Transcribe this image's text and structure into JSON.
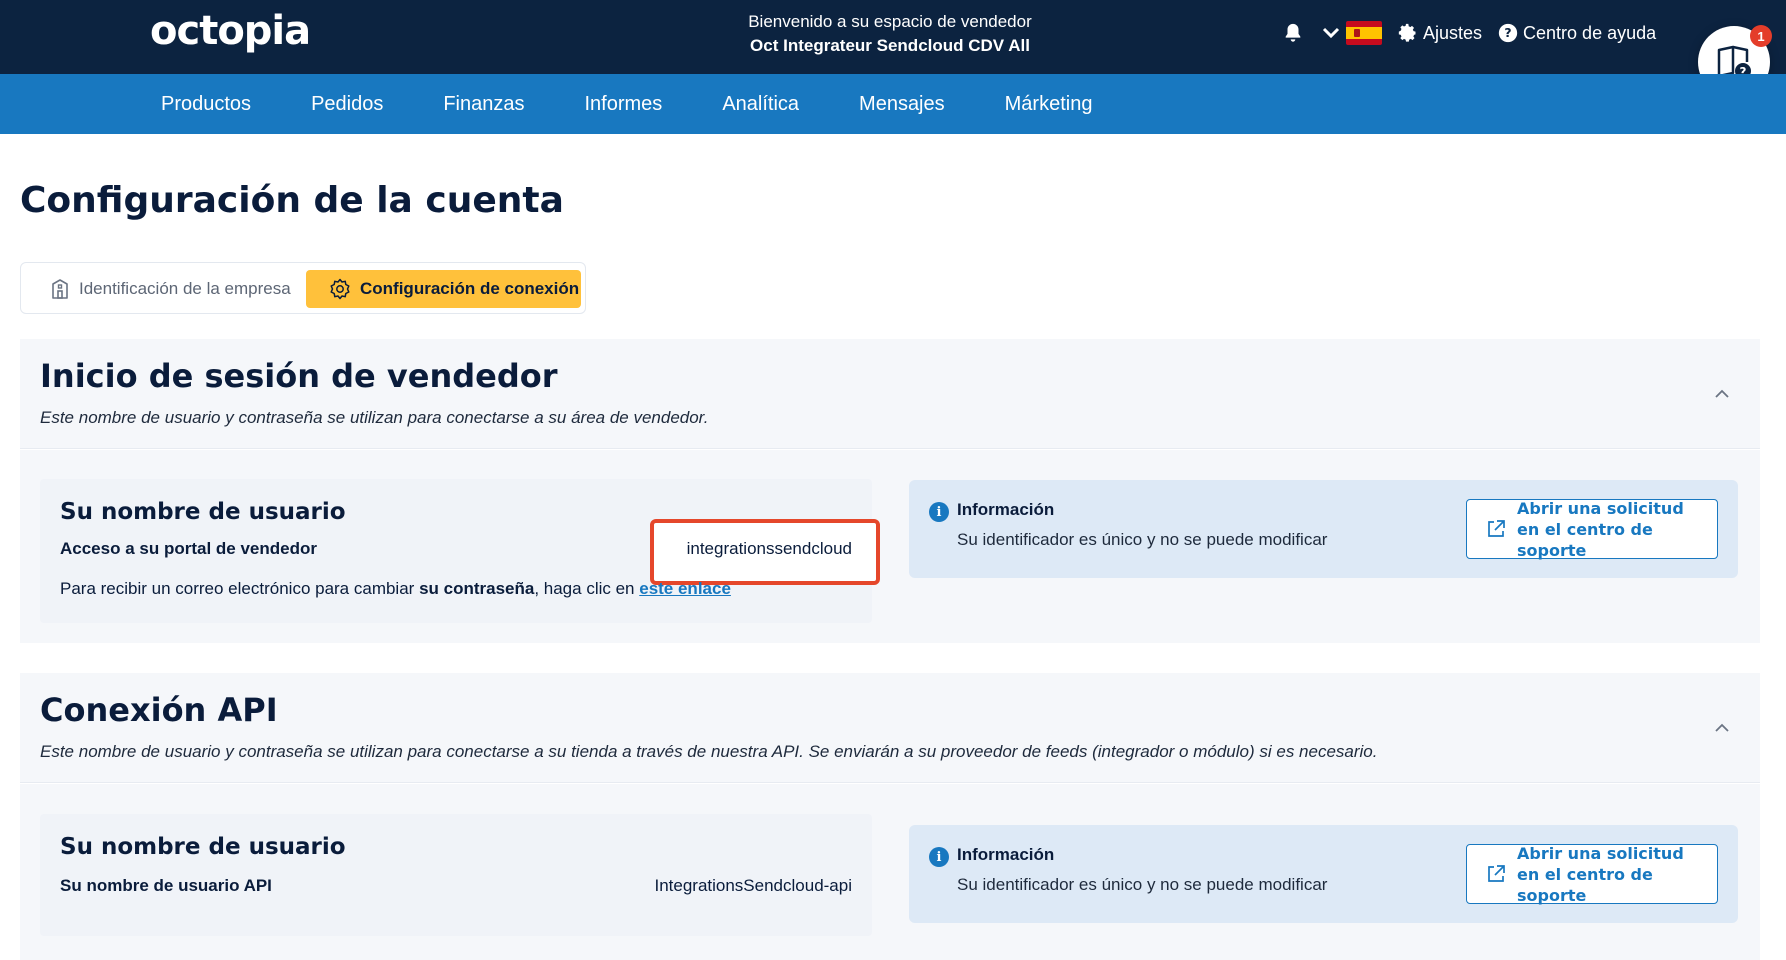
{
  "header": {
    "logo": "octopia",
    "welcome_line": "Bienvenido a su espacio de vendedor",
    "store_name": "Oct Integrateur Sendcloud CDV All",
    "settings_label": "Ajustes",
    "help_center_label": "Centro de ayuda",
    "help_badge_count": "1"
  },
  "nav": {
    "items": [
      "Productos",
      "Pedidos",
      "Finanzas",
      "Informes",
      "Analítica",
      "Mensajes",
      "Márketing"
    ]
  },
  "page": {
    "title": "Configuración de la cuenta"
  },
  "tabs": {
    "company": "Identificación de la empresa",
    "connection": "Configuración de conexión",
    "active": "connection"
  },
  "seller_login": {
    "title": "Inicio de sesión de vendedor",
    "subtitle": "Este nombre de usuario y contraseña se utilizan para conectarse a su área de vendedor.",
    "card_title": "Su nombre de usuario",
    "field_label": "Acceso a su portal de vendedor",
    "field_value": "integrationssendcloud",
    "note_prefix": "Para recibir un correo electrónico para cambiar ",
    "note_bold": "su contraseña",
    "note_mid": ", haga clic en ",
    "note_link": "este enlace",
    "info_title": "Información",
    "info_text": "Su identificador es único y no se puede modificar",
    "support_button": "Abrir una solicitud en el centro de soporte"
  },
  "api_connection": {
    "title": "Conexión API",
    "subtitle": "Este nombre de usuario y contraseña se utilizan para conectarse a su tienda a través de nuestra API. Se enviarán a su proveedor de feeds (integrador o módulo) si es necesario.",
    "card_title": "Su nombre de usuario",
    "field_label": "Su nombre de usuario API",
    "field_value": "IntegrationsSendcloud-api",
    "info_title": "Información",
    "info_text": "Su identificador es único y no se puede modificar",
    "support_button": "Abrir una solicitud en el centro de soporte"
  },
  "colors": {
    "topbar": "#0c2340",
    "navbar": "#1878c0",
    "active_tab": "#ffc13b",
    "highlight_border": "#e5472b",
    "info_card": "#dde9f6",
    "badge": "#e43d2a"
  }
}
